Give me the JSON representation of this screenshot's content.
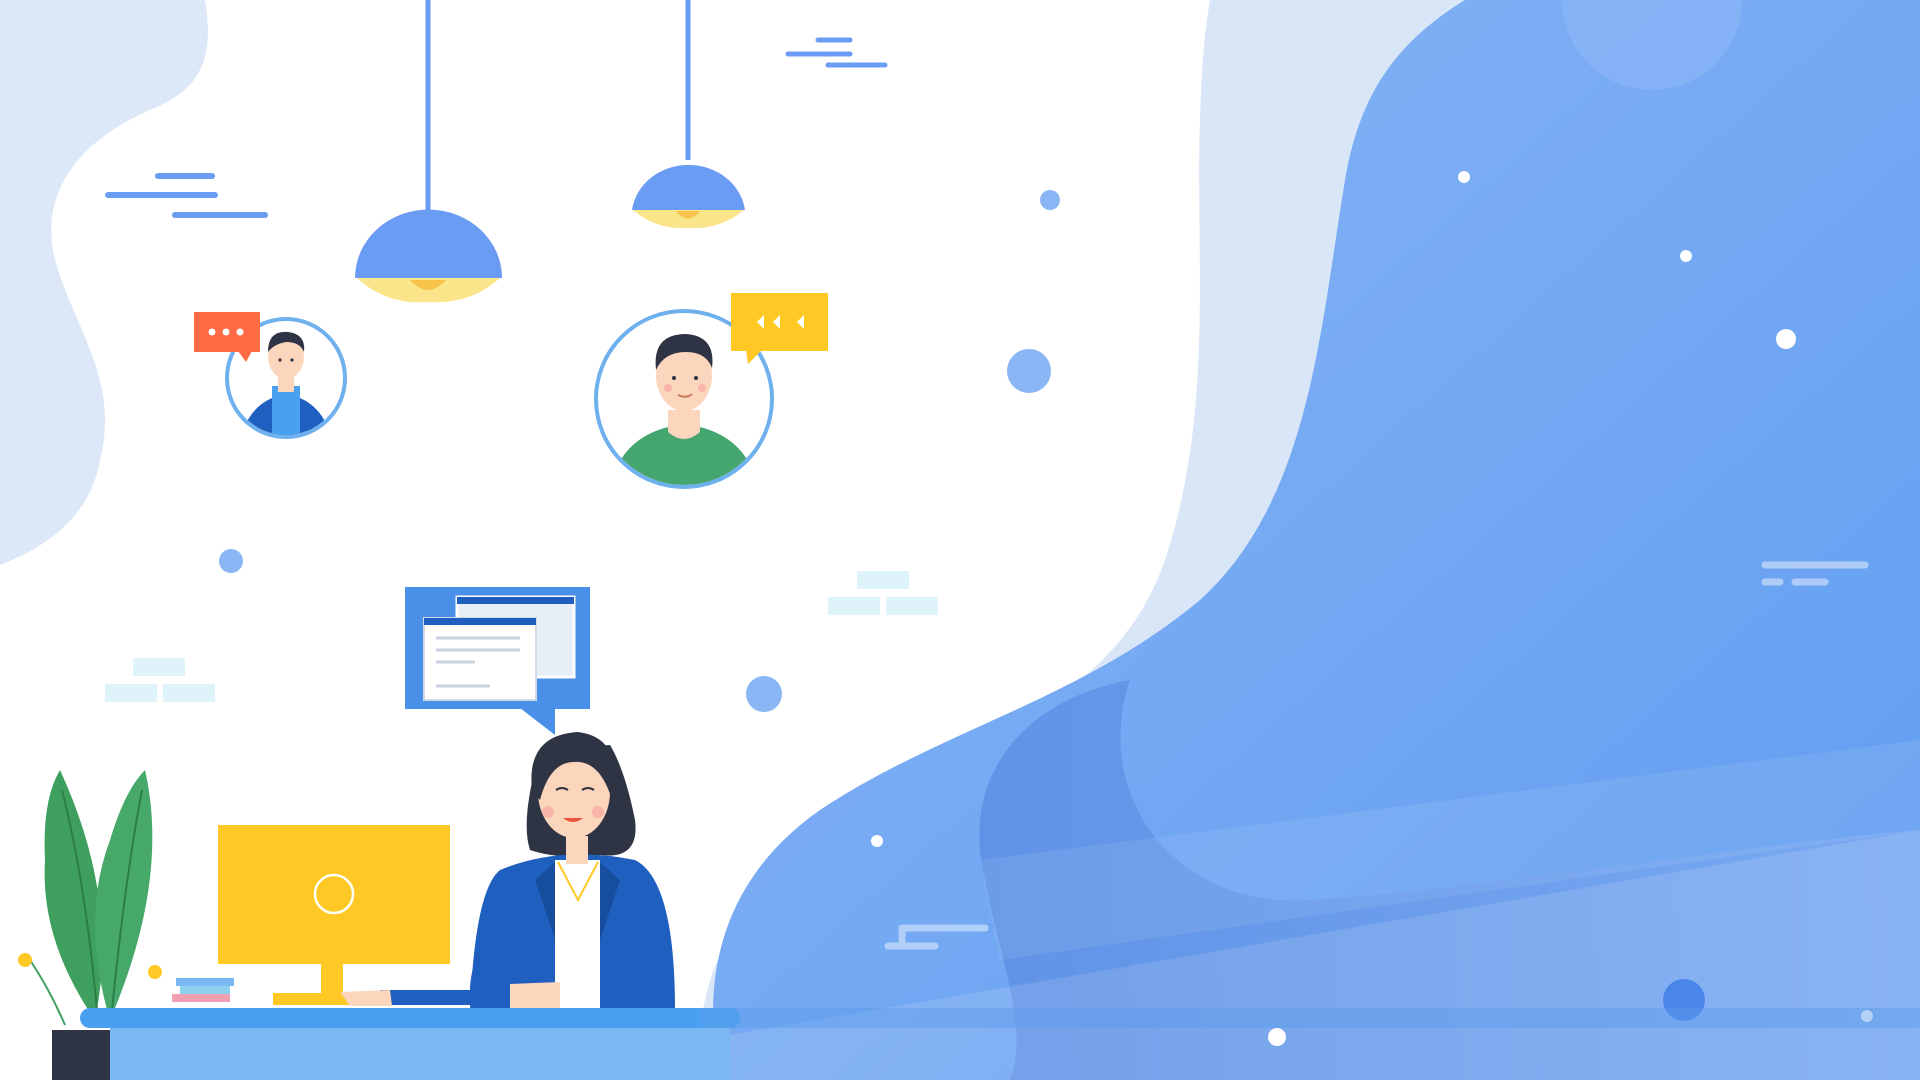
{
  "scene": {
    "description_free": true,
    "colors": {
      "background": "#ffffff",
      "pale_blue": "#d6e4f6",
      "blue_main": "#6fa0f5",
      "blue_deep": "#4a86e8",
      "lamp_blue": "#6b9cf4",
      "lamp_light": "#fbe58a",
      "yellow": "#ffc824",
      "orange_bubble": "#ff6b45",
      "suit_blue": "#1f5fbf",
      "hair": "#2e3444",
      "skin": "#fcd5bd",
      "leaf_green": "#3f9f5f",
      "desk_blue": "#4aa0f0"
    },
    "icons": [
      "pendant-lamp-icon",
      "chat-bubble-dots-icon",
      "chat-bubble-arrows-icon",
      "browser-window-icon",
      "computer-monitor-icon",
      "plant-icon",
      "books-icon"
    ]
  }
}
